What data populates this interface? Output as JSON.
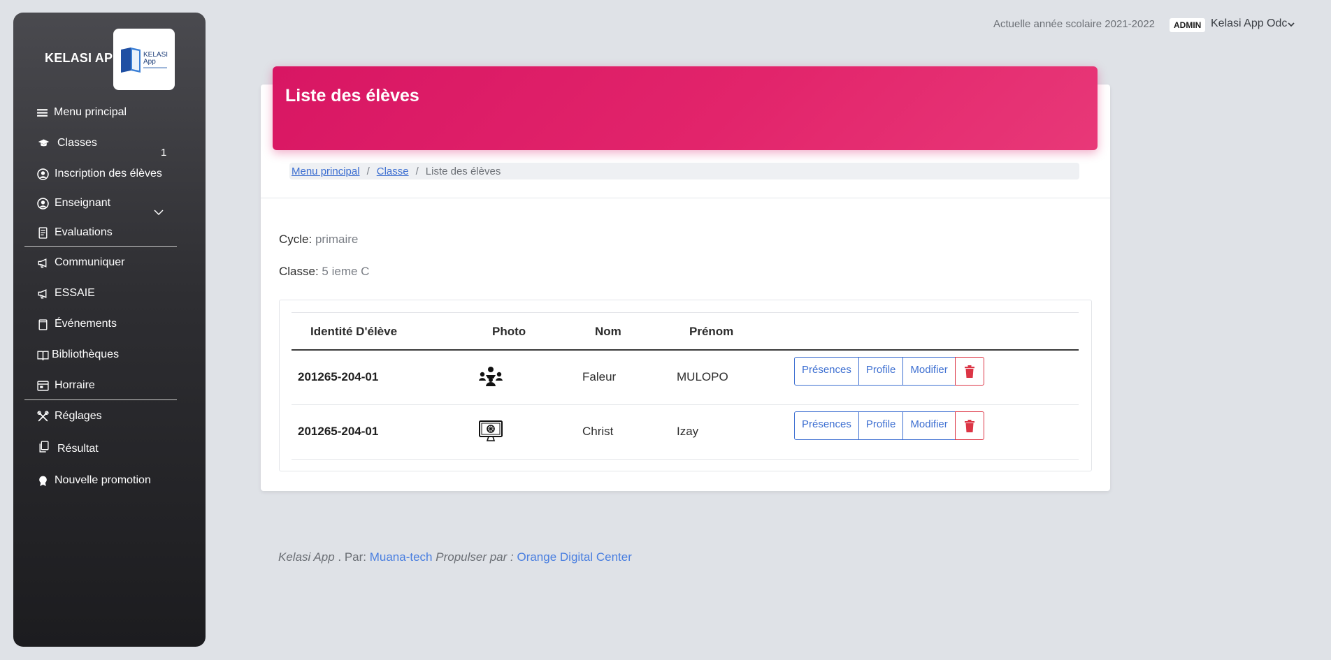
{
  "sidebar": {
    "brand": "KELASI APP",
    "logo_text": "KELASI App",
    "badge_classes": "1",
    "items": [
      {
        "label": "Menu principal",
        "icon": "menu-icon"
      },
      {
        "label": "Classes",
        "icon": "graduation-cap-icon"
      },
      {
        "label": "Inscription des élèves",
        "icon": "user-circle-icon"
      },
      {
        "label": "Enseignant",
        "icon": "user-circle-icon"
      },
      {
        "label": "Evaluations",
        "icon": "document-icon"
      },
      {
        "label": "Communiquer",
        "icon": "megaphone-icon"
      },
      {
        "label": "ESSAIE",
        "icon": "megaphone-icon"
      },
      {
        "label": "Événements",
        "icon": "calendar-icon"
      },
      {
        "label": "Bibliothèques",
        "icon": "book-icon"
      },
      {
        "label": "Horraire",
        "icon": "schedule-icon"
      },
      {
        "label": "Réglages",
        "icon": "tools-icon"
      },
      {
        "label": "Résultat",
        "icon": "copy-icon"
      },
      {
        "label": "Nouvelle promotion",
        "icon": "award-icon"
      }
    ]
  },
  "topbar": {
    "year_text": "Actuelle année scolaire 2021-2022",
    "role_badge": "ADMIN",
    "user_name": "Kelasi App Odc"
  },
  "card": {
    "title": "Liste des élèves",
    "breadcrumb": [
      "Menu principal",
      "Classe",
      "Liste des élèves"
    ],
    "cycle_label": "Cycle:",
    "cycle_value": "primaire",
    "class_label": "Classe:",
    "class_value": "5 ieme C"
  },
  "table": {
    "headers": [
      "Identité D'élève",
      "Photo",
      "Nom",
      "Prénom"
    ],
    "rows": [
      {
        "id": "201265-204-01",
        "photo_icon": "group-icon",
        "nom": "Faleur",
        "prenom": "MULOPO"
      },
      {
        "id": "201265-204-01",
        "photo_icon": "monitor-icon",
        "nom": "Christ",
        "prenom": "Izay"
      }
    ],
    "actions": [
      "Présences",
      "Profile",
      "Modifier"
    ]
  },
  "footer": {
    "app": "Kelasi App",
    "sep": " . Par: ",
    "author": "Muana-tech",
    "powered": " Propulser par : ",
    "partner": "Orange Digital Center"
  },
  "colors": {
    "accent": "#d81663",
    "link": "#3d6fd1",
    "danger": "#dc3545"
  }
}
